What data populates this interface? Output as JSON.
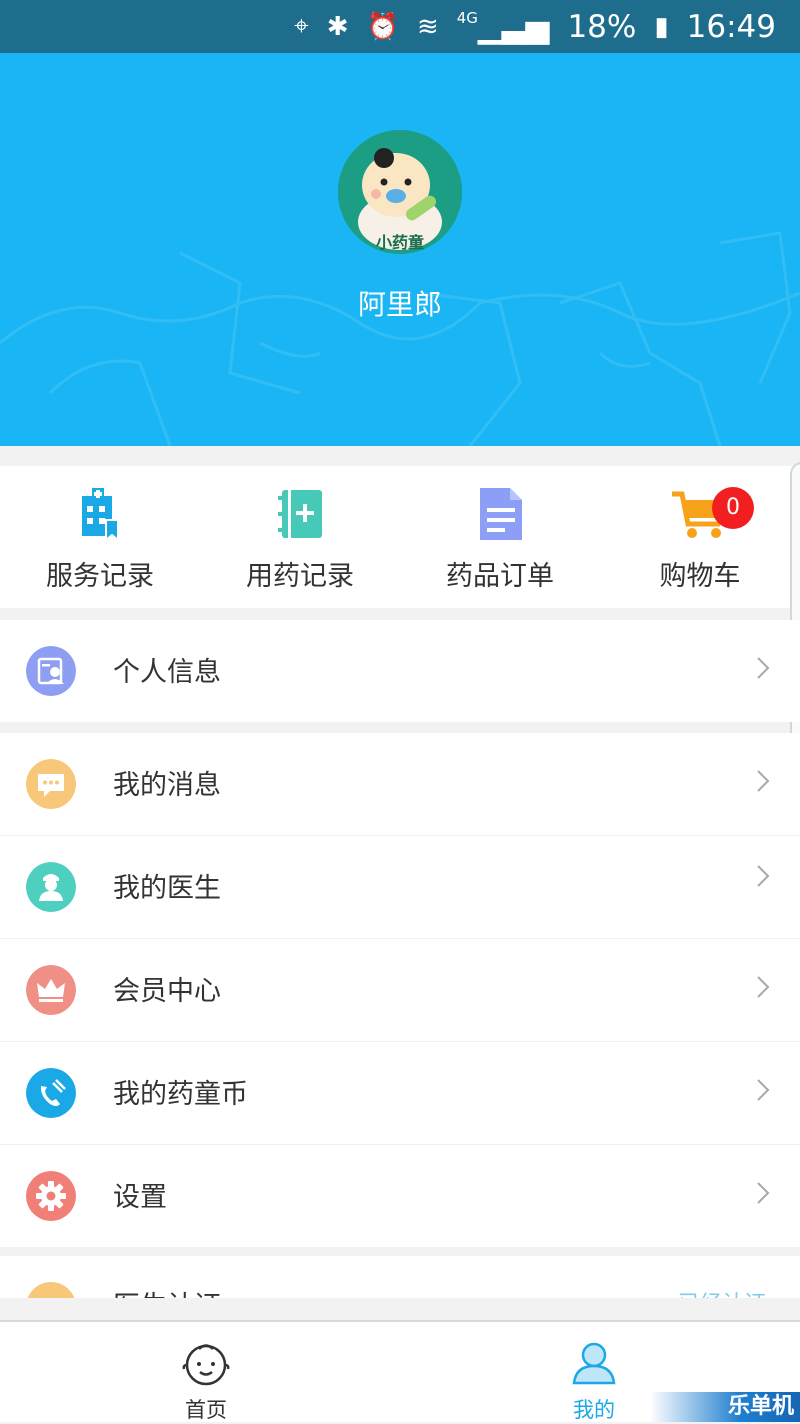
{
  "status_bar": {
    "network": "4G",
    "battery": "18%",
    "time": "16:49"
  },
  "profile": {
    "avatar_caption": "小药童",
    "username": "阿里郎"
  },
  "quick_actions": [
    {
      "label": "服务记录",
      "icon": "hospital-icon",
      "color": "#1aa8e6"
    },
    {
      "label": "用药记录",
      "icon": "medicine-record-icon",
      "color": "#46c9b7"
    },
    {
      "label": "药品订单",
      "icon": "order-document-icon",
      "color": "#8c9ef5"
    },
    {
      "label": "购物车",
      "icon": "shopping-cart-icon",
      "color": "#f7a21b",
      "badge": "0"
    }
  ],
  "menu_groups": [
    [
      {
        "label": "个人信息",
        "icon": "personal-info-icon",
        "color": "#8e9ef2"
      }
    ],
    [
      {
        "label": "我的消息",
        "icon": "message-icon",
        "color": "#f7c77a"
      },
      {
        "label": "我的医生",
        "icon": "doctor-icon",
        "color": "#4fcfbf"
      },
      {
        "label": "会员中心",
        "icon": "crown-icon",
        "color": "#f08f86"
      },
      {
        "label": "我的药童币",
        "icon": "phone-coin-icon",
        "color": "#1aa8e6"
      },
      {
        "label": "设置",
        "icon": "gear-icon",
        "color": "#f07f77"
      }
    ]
  ],
  "partial_row": {
    "label": "医生认证",
    "right_text": "已经认证"
  },
  "bottom_nav": [
    {
      "label": "首页",
      "icon": "baby-face-icon",
      "active": false
    },
    {
      "label": "我的",
      "icon": "user-icon",
      "active": true
    }
  ],
  "watermark": "乐单机",
  "colors": {
    "header": "#1ab5f4",
    "status_bar": "#1f6d8c",
    "active_nav": "#1aa8e6",
    "badge": "#f11f1f"
  }
}
